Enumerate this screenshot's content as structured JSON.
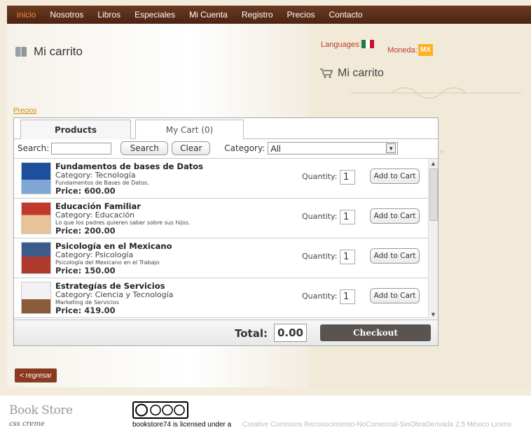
{
  "nav": {
    "items": [
      "inicio",
      "Nosotros",
      "Libros",
      "Especiales",
      "Mi Cuenta",
      "Registro",
      "Precios",
      "Contacto"
    ],
    "active_color": "#ff8a2a"
  },
  "page": {
    "title": "Mi carrito",
    "languages_label": "Languages:",
    "moneda_label": "Moneda:",
    "currency_badge": "MX",
    "cart_heading": "Mi carrito",
    "precios_link": "Precios",
    "back_button": "< regresar"
  },
  "widget": {
    "tabs": {
      "products": "Products",
      "cart": "My Cart (0)"
    },
    "search": {
      "label": "Search:",
      "search_button": "Search",
      "clear_button": "Clear",
      "category_label": "Category:",
      "category_value": "All"
    },
    "quantity_label": "Quantity:",
    "add_button": "Add to Cart",
    "items": [
      {
        "name": "Fundamentos de bases de Datos",
        "category": "Category: Tecnología",
        "description": "Fundamentos de Bases de Datos.",
        "price": "Price: 600.00",
        "quantity": "1",
        "thumb_colors": [
          "#1d4f9c",
          "#7fa6d6"
        ]
      },
      {
        "name": "Educación Familiar",
        "category": "Category: Educación",
        "description": "Lo que los padres quieren saber sobre sus hijos.",
        "price": "Price: 200.00",
        "quantity": "1",
        "thumb_colors": [
          "#c0392b",
          "#e8c39a"
        ]
      },
      {
        "name": "Psicología en el Mexicano",
        "category": "Category: Psicología",
        "description": "Psicología del Mexicano en el Trabajo",
        "price": "Price: 150.00",
        "quantity": "1",
        "thumb_colors": [
          "#3b5b8c",
          "#b03a2e"
        ]
      },
      {
        "name": "Estrategías de Servicios",
        "category": "Category: Ciencia y Tecnología",
        "description": "Marketing de Servicios",
        "price": "Price: 419.00",
        "quantity": "1",
        "thumb_colors": [
          "#f2f2f2",
          "#8a5a3a"
        ]
      }
    ],
    "total_label": "Total:",
    "total_value": "0.00",
    "checkout_button": "Checkout"
  },
  "footer": {
    "brand": "Book Store",
    "brand_sub": "css creme",
    "license_text": "bookstore74 is licensed under a",
    "license_link": "Creative Commons Reconocimiento-NoComercial-SinObraDerivada 2.5 México Licens"
  }
}
